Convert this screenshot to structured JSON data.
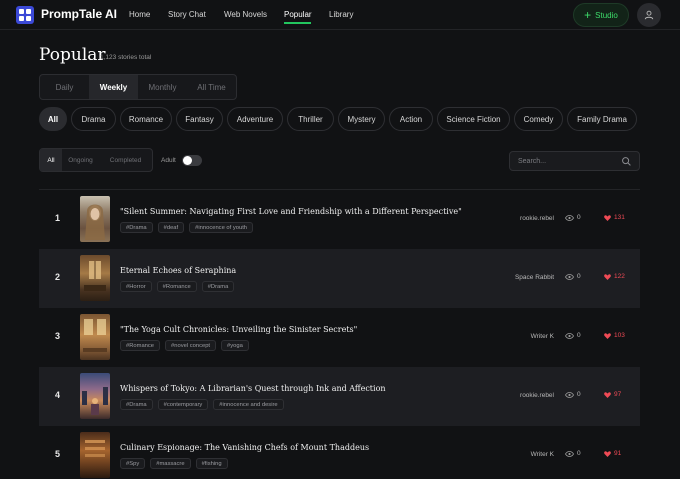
{
  "app": {
    "name": "PrompTale AI"
  },
  "nav": {
    "home": "Home",
    "story_chat": "Story Chat",
    "web_novels": "Web Novels",
    "popular": "Popular",
    "library": "Library"
  },
  "studio": {
    "label": "Studio"
  },
  "page": {
    "title": "Popular",
    "count": "1,123 stories total"
  },
  "periods": [
    "Daily",
    "Weekly",
    "Monthly",
    "All Time"
  ],
  "genres": [
    "All",
    "Drama",
    "Romance",
    "Fantasy",
    "Adventure",
    "Thriller",
    "Mystery",
    "Action",
    "Science Fiction",
    "Comedy",
    "Family Drama"
  ],
  "filters": [
    "All",
    "Ongoing",
    "Completed"
  ],
  "adult_label": "Adult",
  "adult_enabled": false,
  "search": {
    "placeholder": "Search..."
  },
  "stories": [
    {
      "rank": "1",
      "title": "\"Silent Summer: Navigating First Love and Friendship with a Different Perspective\"",
      "tags": [
        "#Drama",
        "#deaf",
        "#innocence of youth"
      ],
      "author": "rookie.rebel",
      "views": "0",
      "likes": "131"
    },
    {
      "rank": "2",
      "title": "Eternal Echoes of Seraphina",
      "tags": [
        "#Horror",
        "#Romance",
        "#Drama"
      ],
      "author": "Space Rabbit",
      "views": "0",
      "likes": "122"
    },
    {
      "rank": "3",
      "title": "\"The Yoga Cult Chronicles: Unveiling the Sinister Secrets\"",
      "tags": [
        "#Romance",
        "#novel concept",
        "#yoga"
      ],
      "author": "Writer K",
      "views": "0",
      "likes": "103"
    },
    {
      "rank": "4",
      "title": "Whispers of Tokyo: A Librarian's Quest through Ink and Affection",
      "tags": [
        "#Drama",
        "#contemporary",
        "#innocence and desire"
      ],
      "author": "rookie.rebel",
      "views": "0",
      "likes": "97"
    },
    {
      "rank": "5",
      "title": "Culinary Espionage: The Vanishing Chefs of Mount Thaddeus",
      "tags": [
        "#Spy",
        "#massacre",
        "#fishing"
      ],
      "author": "Writer K",
      "views": "0",
      "likes": "91"
    }
  ]
}
